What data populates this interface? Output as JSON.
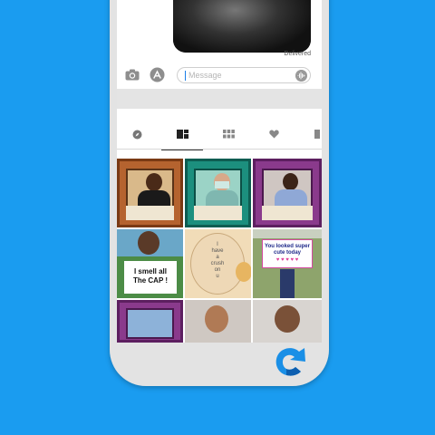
{
  "conversation": {
    "status": "Delivered"
  },
  "composer": {
    "placeholder": "Message",
    "icons": [
      "camera-icon",
      "app-store-icon",
      "audio-waveform-icon"
    ]
  },
  "sticker_tabs": [
    {
      "icon": "compass-icon",
      "active": false
    },
    {
      "icon": "sticker-collection-icon",
      "active": true
    },
    {
      "icon": "grid-icon",
      "active": false
    },
    {
      "icon": "heart-icon",
      "active": false
    },
    {
      "icon": "flag-icon",
      "active": false
    }
  ],
  "stickers": {
    "sign_cap": {
      "line1": "I smell all",
      "line2": "The CAP !"
    },
    "paper_note": {
      "lines": [
        "I",
        "have",
        "a",
        "crush",
        "on",
        "u"
      ]
    },
    "sign_cute": {
      "line1": "You looked super",
      "line2": "cute today"
    }
  },
  "colors": {
    "background": "#1a9cf0",
    "accent_caret": "#1a7ee8"
  },
  "app_badge": {
    "icon": "refresh-c-logo-icon"
  }
}
